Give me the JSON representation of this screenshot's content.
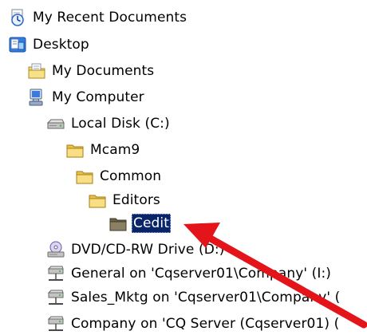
{
  "tree": {
    "items": [
      {
        "label": "My Recent Documents",
        "icon": "recent-documents-icon"
      },
      {
        "label": "Desktop",
        "icon": "desktop-icon"
      },
      {
        "label": "My Documents",
        "icon": "my-documents-icon"
      },
      {
        "label": "My Computer",
        "icon": "my-computer-icon"
      },
      {
        "label": "Local Disk (C:)",
        "icon": "local-disk-icon"
      },
      {
        "label": "Mcam9",
        "icon": "folder-icon"
      },
      {
        "label": "Common",
        "icon": "folder-icon"
      },
      {
        "label": "Editors",
        "icon": "folder-icon"
      },
      {
        "label": "Cedit",
        "icon": "folder-icon",
        "selected": true
      },
      {
        "label": "DVD/CD-RW Drive (D:)",
        "icon": "dvd-drive-icon"
      },
      {
        "label": "General on 'Cqserver01\\Company' (I:)",
        "icon": "network-drive-icon"
      },
      {
        "label": "Sales_Mktg on 'Cqserver01\\Company' (",
        "icon": "network-drive-icon"
      },
      {
        "label": "Company on 'CQ Server (Cqserver01) (",
        "icon": "network-drive-icon"
      }
    ]
  },
  "colors": {
    "selection": "#0a246a",
    "annotation_arrow": "#e3151b",
    "folder": "#f5d86a"
  }
}
